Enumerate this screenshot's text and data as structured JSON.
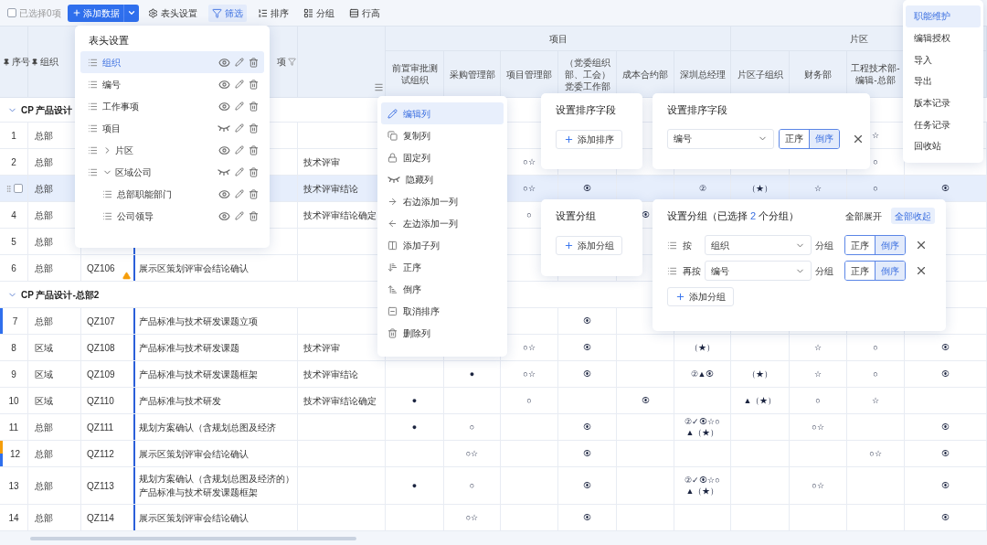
{
  "toolbar": {
    "selection": {
      "label": "已选择0项",
      "checked": false
    },
    "add_button": {
      "label": "添加数据"
    },
    "tools": [
      {
        "label": "表头设置",
        "selected": false
      },
      {
        "label": "筛选",
        "selected": true
      },
      {
        "label": "排序",
        "selected": false
      },
      {
        "label": "分组",
        "selected": false
      },
      {
        "label": "行高",
        "selected": false
      }
    ]
  },
  "table": {
    "leading_columns": [
      {
        "label": "序号",
        "pinned": true
      },
      {
        "label": "组织",
        "pinned": true
      },
      null,
      {
        "label": "项",
        "filter": true
      },
      {
        "menu": true
      }
    ],
    "column_groups": [
      {
        "label": "项目",
        "columns": [
          "前置审批测试组织",
          "采购管理部",
          "项目管理部",
          "（党委组织部、工会）党委工作部",
          "成本合约部",
          "深圳总经理"
        ]
      },
      {
        "label": "片区",
        "columns": [
          "片区子组织",
          "财务部",
          "工程技术部-编辑-总部",
          null
        ]
      }
    ],
    "sections": [
      {
        "title": "CP 产品设计",
        "expanded": true,
        "rows": [
          {
            "seq": "1",
            "org": "总部",
            "selected": false,
            "cells": [
              null,
              null,
              null,
              null,
              null,
              null,
              null,
              null,
              null,
              "☆",
              null
            ]
          },
          {
            "seq": "2",
            "org": "总部",
            "selected": false,
            "cells": [
              "技术评审",
              null,
              null,
              "○☆",
              null,
              null,
              null,
              null,
              null,
              "○",
              null
            ]
          },
          {
            "checked": false,
            "org": "总部",
            "selected": true,
            "cells": [
              "技术评审结论",
              null,
              null,
              "○☆",
              "⦿",
              null,
              "②",
              "（★）",
              "☆",
              "○",
              "⦿"
            ]
          },
          {
            "seq": "4",
            "org": "总部",
            "selected": false,
            "cells": [
              "技术评审结论确定",
              null,
              null,
              "○",
              null,
              "⦿",
              null,
              null,
              null,
              null,
              null
            ]
          },
          {
            "seq": "5",
            "org": "总部",
            "selected": false,
            "warning": false,
            "cells": [
              null,
              null,
              null,
              null,
              null,
              null,
              null,
              null,
              null,
              null,
              null
            ]
          },
          {
            "seq": "6",
            "org": "总部",
            "code": "QZ106",
            "item": "展示区策划评审会结论确认",
            "selected": false,
            "warning": true,
            "cells": [
              null,
              null,
              null,
              null,
              null,
              null,
              null,
              null,
              null,
              null,
              null
            ]
          }
        ]
      },
      {
        "title": "CP 产品设计-总部2",
        "expanded": true,
        "rows": [
          {
            "seq": "7",
            "org": "总部",
            "code": "QZ107",
            "item": "产品标准与技术研发课题立项",
            "selected": false,
            "warning": false,
            "markers": [
              {
                "color": "#2f6fed"
              }
            ],
            "cells": [
              null,
              null,
              null,
              null,
              "⦿",
              null,
              null,
              null,
              null,
              null,
              null
            ]
          },
          {
            "seq": "8",
            "org": "区域",
            "code": "QZ108",
            "item": "产品标准与技术研发课题",
            "selected": false,
            "warning": false,
            "cells": [
              "技术评审",
              null,
              null,
              "○☆",
              "⦿",
              null,
              "（★）",
              null,
              "☆",
              "○",
              "⦿"
            ]
          },
          {
            "seq": "9",
            "org": "区域",
            "code": "QZ109",
            "item": "产品标准与技术研发课题框架",
            "selected": false,
            "warning": false,
            "cells": [
              "技术评审结论",
              null,
              "●",
              "○☆",
              "⦿",
              null,
              "②▲⦿",
              "（★）",
              "☆",
              "○",
              "⦿"
            ]
          },
          {
            "seq": "10",
            "org": "区域",
            "code": "QZ110",
            "item": "产品标准与技术研发",
            "selected": false,
            "warning": false,
            "cells": [
              "技术评审结论确定",
              "●",
              null,
              "○",
              null,
              "⦿",
              null,
              "▲（★）",
              "○",
              "☆",
              null
            ]
          },
          {
            "seq": "11",
            "org": "总部",
            "code": "QZ111",
            "item": "规划方案确认（含规划总图及经济",
            "selected": false,
            "warning": false,
            "cells": [
              null,
              "●",
              "○",
              null,
              "⦿",
              null,
              "②✓⦿☆○\n▲（★）",
              null,
              "○☆",
              null,
              "⦿"
            ]
          },
          {
            "seq": "12",
            "org": "总部",
            "code": "QZ112",
            "item": "展示区策划评审会结论确认",
            "selected": false,
            "warning": false,
            "markers": [
              {
                "color": "#f59e0b"
              },
              {
                "color": "#2f6fed"
              }
            ],
            "cells": [
              null,
              null,
              "○☆",
              null,
              "⦿",
              null,
              null,
              null,
              null,
              "○☆",
              "⦿"
            ]
          },
          {
            "seq": "13",
            "org": "总部",
            "code": "QZ113",
            "item": "规划方案确认（含规划总图及经济的）产品标准与技术研发课题框架",
            "selected": false,
            "warning": false,
            "cells": [
              null,
              "●",
              "○",
              null,
              "⦿",
              null,
              "②✓⦿☆○\n▲（★）",
              null,
              "○☆",
              null,
              "⦿"
            ]
          },
          {
            "seq": "14",
            "org": "总部",
            "code": "QZ114",
            "item": "展示区策划评审会结论确认",
            "selected": false,
            "warning": false,
            "cells": [
              null,
              null,
              "○☆",
              null,
              "⦿",
              null,
              null,
              null,
              null,
              null,
              "⦿"
            ]
          }
        ]
      }
    ]
  },
  "column_settings": {
    "title": "表头设置",
    "items": [
      {
        "label": "组织",
        "selected": true,
        "visible": true
      },
      {
        "label": "编号",
        "selected": false,
        "visible": true
      },
      {
        "label": "工作事项",
        "selected": false,
        "visible": true
      },
      {
        "label": "项目",
        "selected": false,
        "visible": false
      },
      {
        "label": "片区",
        "selected": false,
        "visible": true,
        "expanded": false
      },
      {
        "label": "区域公司",
        "selected": false,
        "visible": false,
        "expanded": true,
        "children": [
          {
            "label": "总部职能部门",
            "selected": false,
            "visible": true
          },
          {
            "label": "公司领导",
            "selected": false,
            "visible": true
          }
        ]
      }
    ]
  },
  "column_menu": {
    "items": [
      {
        "label": "编辑列",
        "selected": true
      },
      {
        "label": "复制列",
        "selected": false
      },
      {
        "label": "固定列",
        "selected": false
      },
      {
        "label": "隐藏列",
        "selected": false
      },
      {
        "label": "右边添加一列",
        "selected": false
      },
      {
        "label": "左边添加一列",
        "selected": false
      },
      {
        "label": "添加子列",
        "selected": false
      },
      {
        "label": "正序",
        "selected": false
      },
      {
        "label": "倒序",
        "selected": false
      },
      {
        "label": "取消排序",
        "selected": false
      },
      {
        "label": "删除列",
        "selected": false
      }
    ]
  },
  "sort_empty": {
    "title": "设置排序字段",
    "add_button": "添加排序"
  },
  "sort_panel": {
    "title": "设置排序字段",
    "rules": [
      {
        "field": "编号",
        "orders": [
          {
            "label": "正序",
            "selected": false
          },
          {
            "label": "倒序",
            "selected": true
          }
        ]
      }
    ]
  },
  "group_empty": {
    "title": "设置分组",
    "add_button": "添加分组"
  },
  "group_panel": {
    "title": "设置分组（已选择",
    "count": "2",
    "title_end": "个分组）",
    "actions": [
      {
        "label": "全部展开",
        "selected": false
      },
      {
        "label": "全部收起",
        "selected": true
      }
    ],
    "rules": [
      {
        "prefix": "按",
        "field": "组织",
        "suffix": "分组",
        "orders": [
          {
            "label": "正序",
            "selected": false
          },
          {
            "label": "倒序",
            "selected": true
          }
        ]
      },
      {
        "prefix": "再按",
        "field": "编号",
        "suffix": "分组",
        "orders": [
          {
            "label": "正序",
            "selected": false
          },
          {
            "label": "倒序",
            "selected": true
          }
        ]
      }
    ],
    "add_button": "添加分组"
  },
  "more_menu": {
    "items": [
      {
        "label": "职能维护",
        "selected": true
      },
      {
        "label": "编辑授权",
        "selected": false
      },
      {
        "label": "导入",
        "selected": false
      },
      {
        "label": "导出",
        "selected": false
      },
      {
        "label": "版本记录",
        "selected": false
      },
      {
        "label": "任务记录",
        "selected": false
      },
      {
        "label": "回收站",
        "selected": false
      }
    ]
  }
}
